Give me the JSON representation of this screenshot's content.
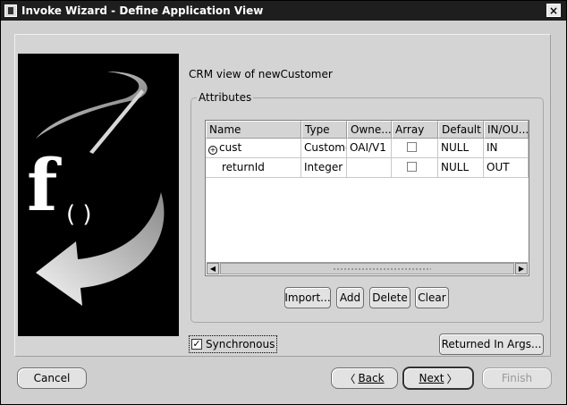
{
  "window": {
    "title": "Invoke Wizard - Define Application View",
    "close_glyph": "×"
  },
  "view_label": "CRM view of newCustomer",
  "attributes": {
    "legend": "Attributes",
    "columns": [
      "Name",
      "Type",
      "Owne...",
      "Array",
      "Default",
      "IN/OU..."
    ],
    "rows": [
      {
        "name": "cust",
        "type": "Custome",
        "owner": "OAI/V1",
        "array": false,
        "default": "NULL",
        "inout": "IN",
        "expandable": true
      },
      {
        "name": "returnId",
        "type": "Integer",
        "owner": "",
        "array": false,
        "default": "NULL",
        "inout": "OUT",
        "expandable": false
      }
    ],
    "buttons": {
      "import": "Import...",
      "add": "Add",
      "delete": "Delete",
      "clear": "Clear"
    }
  },
  "synchronous": {
    "label": "Synchronous",
    "checked": true
  },
  "returned_in_args": "Returned In Args...",
  "footer": {
    "cancel": "Cancel",
    "back": "Back",
    "next": "Next",
    "finish": "Finish"
  },
  "icons": {
    "expand": "expand-icon",
    "back_arrow": "chevron-left-icon",
    "next_arrow": "chevron-right-icon"
  }
}
